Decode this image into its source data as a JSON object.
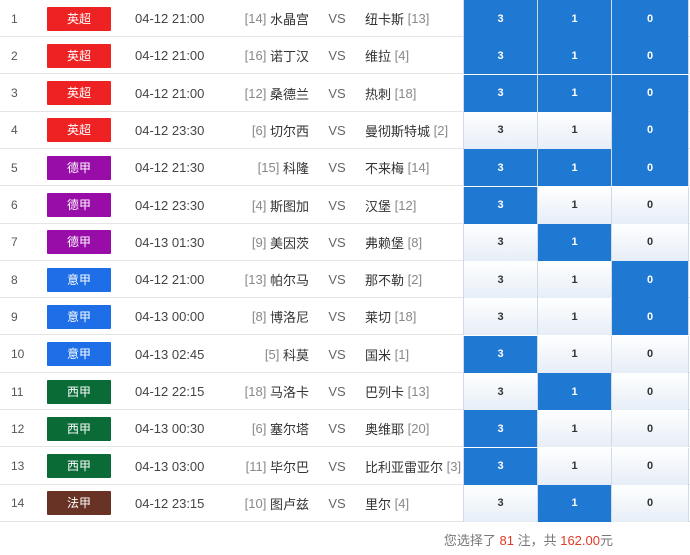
{
  "colors": {
    "selected": "#1f78d1",
    "英超": "#ee2222",
    "德甲": "#980ca8",
    "意甲": "#1e6ee8",
    "西甲": "#0a6b36",
    "法甲": "#683225",
    "highlight": "#e03c28"
  },
  "matches": [
    {
      "idx": "1",
      "league": "英超",
      "time": "04-12 21:00",
      "home_rank": "[14]",
      "home": "水晶宫",
      "vs": "VS",
      "away": "纽卡斯",
      "away_rank": "[13]",
      "odds": [
        "3",
        "1",
        "0"
      ],
      "selected": [
        true,
        true,
        true
      ]
    },
    {
      "idx": "2",
      "league": "英超",
      "time": "04-12 21:00",
      "home_rank": "[16]",
      "home": "诺丁汉",
      "vs": "VS",
      "away": "维拉",
      "away_rank": "[4]",
      "odds": [
        "3",
        "1",
        "0"
      ],
      "selected": [
        true,
        true,
        true
      ]
    },
    {
      "idx": "3",
      "league": "英超",
      "time": "04-12 21:00",
      "home_rank": "[12]",
      "home": "桑德兰",
      "vs": "VS",
      "away": "热刺",
      "away_rank": "[18]",
      "odds": [
        "3",
        "1",
        "0"
      ],
      "selected": [
        true,
        true,
        true
      ]
    },
    {
      "idx": "4",
      "league": "英超",
      "time": "04-12 23:30",
      "home_rank": "[6]",
      "home": "切尔西",
      "vs": "VS",
      "away": "曼彻斯特城",
      "away_rank": "[2]",
      "odds": [
        "3",
        "1",
        "0"
      ],
      "selected": [
        false,
        false,
        true
      ]
    },
    {
      "idx": "5",
      "league": "德甲",
      "time": "04-12 21:30",
      "home_rank": "[15]",
      "home": "科隆",
      "vs": "VS",
      "away": "不来梅",
      "away_rank": "[14]",
      "odds": [
        "3",
        "1",
        "0"
      ],
      "selected": [
        true,
        true,
        true
      ]
    },
    {
      "idx": "6",
      "league": "德甲",
      "time": "04-12 23:30",
      "home_rank": "[4]",
      "home": "斯图加",
      "vs": "VS",
      "away": "汉堡",
      "away_rank": "[12]",
      "odds": [
        "3",
        "1",
        "0"
      ],
      "selected": [
        true,
        false,
        false
      ]
    },
    {
      "idx": "7",
      "league": "德甲",
      "time": "04-13 01:30",
      "home_rank": "[9]",
      "home": "美因茨",
      "vs": "VS",
      "away": "弗赖堡",
      "away_rank": "[8]",
      "odds": [
        "3",
        "1",
        "0"
      ],
      "selected": [
        false,
        true,
        false
      ]
    },
    {
      "idx": "8",
      "league": "意甲",
      "time": "04-12 21:00",
      "home_rank": "[13]",
      "home": "帕尔马",
      "vs": "VS",
      "away": "那不勒",
      "away_rank": "[2]",
      "odds": [
        "3",
        "1",
        "0"
      ],
      "selected": [
        false,
        false,
        true
      ]
    },
    {
      "idx": "9",
      "league": "意甲",
      "time": "04-13 00:00",
      "home_rank": "[8]",
      "home": "博洛尼",
      "vs": "VS",
      "away": "莱切",
      "away_rank": "[18]",
      "odds": [
        "3",
        "1",
        "0"
      ],
      "selected": [
        false,
        false,
        true
      ]
    },
    {
      "idx": "10",
      "league": "意甲",
      "time": "04-13 02:45",
      "home_rank": "[5]",
      "home": "科莫",
      "vs": "VS",
      "away": "国米",
      "away_rank": "[1]",
      "odds": [
        "3",
        "1",
        "0"
      ],
      "selected": [
        true,
        false,
        false
      ]
    },
    {
      "idx": "11",
      "league": "西甲",
      "time": "04-12 22:15",
      "home_rank": "[18]",
      "home": "马洛卡",
      "vs": "VS",
      "away": "巴列卡",
      "away_rank": "[13]",
      "odds": [
        "3",
        "1",
        "0"
      ],
      "selected": [
        false,
        true,
        false
      ]
    },
    {
      "idx": "12",
      "league": "西甲",
      "time": "04-13 00:30",
      "home_rank": "[6]",
      "home": "塞尔塔",
      "vs": "VS",
      "away": "奥维耶",
      "away_rank": "[20]",
      "odds": [
        "3",
        "1",
        "0"
      ],
      "selected": [
        true,
        false,
        false
      ]
    },
    {
      "idx": "13",
      "league": "西甲",
      "time": "04-13 03:00",
      "home_rank": "[11]",
      "home": "毕尔巴",
      "vs": "VS",
      "away": "比利亚雷亚尔",
      "away_rank": "[3]",
      "odds": [
        "3",
        "1",
        "0"
      ],
      "selected": [
        true,
        false,
        false
      ]
    },
    {
      "idx": "14",
      "league": "法甲",
      "time": "04-12 23:15",
      "home_rank": "[10]",
      "home": "图卢兹",
      "vs": "VS",
      "away": "里尔",
      "away_rank": "[4]",
      "odds": [
        "3",
        "1",
        "0"
      ],
      "selected": [
        false,
        true,
        false
      ]
    }
  ],
  "footer": {
    "prefix": "您选择了",
    "count": "81",
    "mid": "注，共",
    "amount": "162.00",
    "suffix": "元"
  }
}
